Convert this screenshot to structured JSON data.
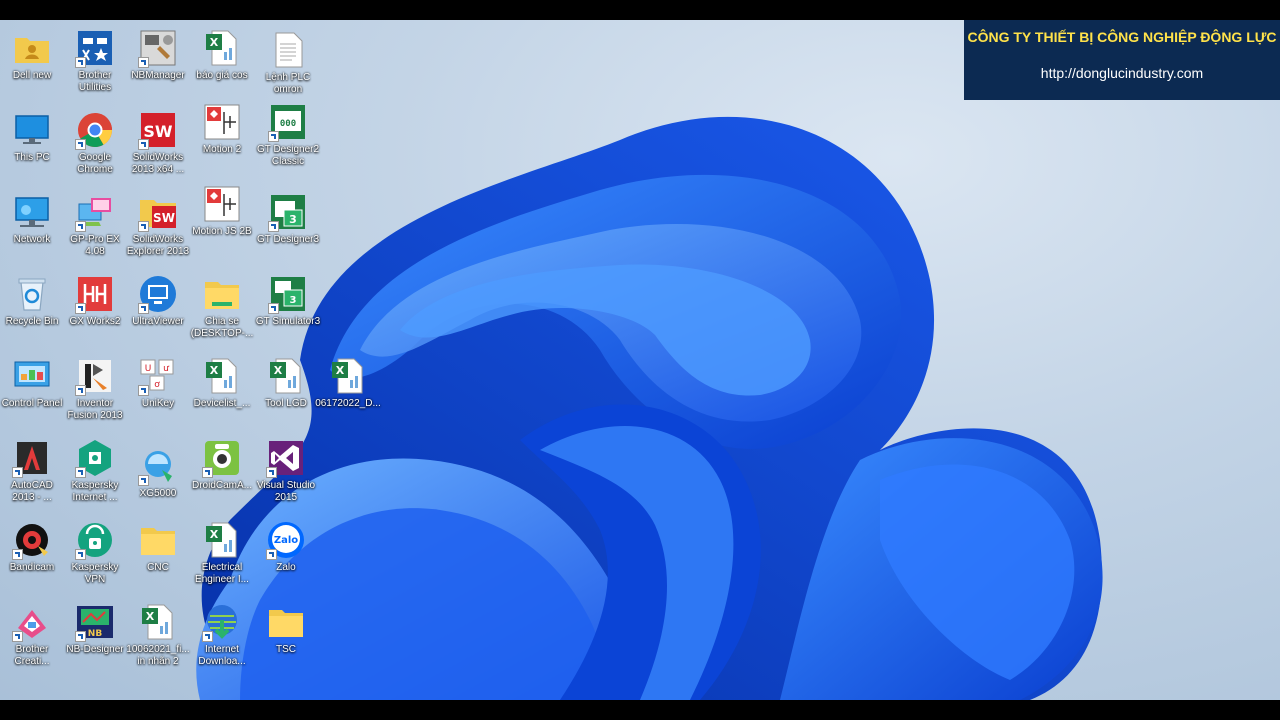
{
  "brand": {
    "company": "CÔNG TY THIẾT BỊ CÔNG NGHIỆP ĐỘNG LỰC",
    "url": "http://donglucindustry.com"
  },
  "desktop_icons": [
    {
      "label": "Dell new",
      "icon": "folder-user-icon"
    },
    {
      "label": "Brother Utilities",
      "icon": "brother-utilities-icon"
    },
    {
      "label": "NBManager",
      "icon": "nbmanager-icon"
    },
    {
      "label": "báo giá cos",
      "icon": "excel-file-icon"
    },
    {
      "label": "Lệnh PLC omron",
      "icon": "text-file-icon"
    },
    {
      "label": "This PC",
      "icon": "monitor-icon"
    },
    {
      "label": "Google Chrome",
      "icon": "chrome-icon"
    },
    {
      "label": "SolidWorks 2013 x64 ...",
      "icon": "solidworks-icon"
    },
    {
      "label": "Motion 2",
      "icon": "motion-icon"
    },
    {
      "label": "GT Designer2 Classic",
      "icon": "gt-designer-icon"
    },
    {
      "label": "Network",
      "icon": "network-icon"
    },
    {
      "label": "GP-Pro EX 4.08",
      "icon": "gp-pro-icon"
    },
    {
      "label": "SolidWorks Explorer 2013",
      "icon": "solidworks-explorer-icon"
    },
    {
      "label": "Motion JS 2B",
      "icon": "motion-icon"
    },
    {
      "label": "GT Designer3",
      "icon": "gt-designer-icon"
    },
    {
      "label": "Recycle Bin",
      "icon": "recycle-bin-icon"
    },
    {
      "label": "GX Works2",
      "icon": "gx-works-icon"
    },
    {
      "label": "UltraViewer",
      "icon": "ultraviewer-icon"
    },
    {
      "label": "Chia se (DESKTOP-...",
      "icon": "folder-icon"
    },
    {
      "label": "GT Simulator3",
      "icon": "gt-simulator-icon"
    },
    {
      "label": "Control Panel",
      "icon": "control-panel-icon"
    },
    {
      "label": "Inventor Fusion 2013",
      "icon": "inventor-icon"
    },
    {
      "label": "UniKey",
      "icon": "unikey-icon"
    },
    {
      "label": "Devicelist_...",
      "icon": "excel-file-icon"
    },
    {
      "label": "Tool LGD",
      "icon": "excel-file-icon"
    },
    {
      "label": "06172022_D...",
      "icon": "excel-file-icon"
    },
    {
      "label": "AutoCAD 2013 - ...",
      "icon": "autocad-icon"
    },
    {
      "label": "Kaspersky Internet ...",
      "icon": "kaspersky-icon"
    },
    {
      "label": "XG5000",
      "icon": "xg5000-icon"
    },
    {
      "label": "DroidCamA...",
      "icon": "droidcam-icon"
    },
    {
      "label": "Visual Studio 2015",
      "icon": "visual-studio-icon"
    },
    {
      "label": "Bandicam",
      "icon": "bandicam-icon"
    },
    {
      "label": "Kaspersky VPN",
      "icon": "kaspersky-vpn-icon"
    },
    {
      "label": "CNC",
      "icon": "folder-icon"
    },
    {
      "label": "Electrical Engineer I...",
      "icon": "excel-file-icon"
    },
    {
      "label": "Zalo",
      "icon": "zalo-icon"
    },
    {
      "label": "Brother Creati...",
      "icon": "brother-creative-icon"
    },
    {
      "label": "NB-Designer",
      "icon": "nb-designer-icon"
    },
    {
      "label": "10062021_fi... in nhãn 2",
      "icon": "excel-file-icon"
    },
    {
      "label": "Internet Downloa...",
      "icon": "idm-icon"
    },
    {
      "label": "TSC",
      "icon": "folder-icon"
    }
  ]
}
